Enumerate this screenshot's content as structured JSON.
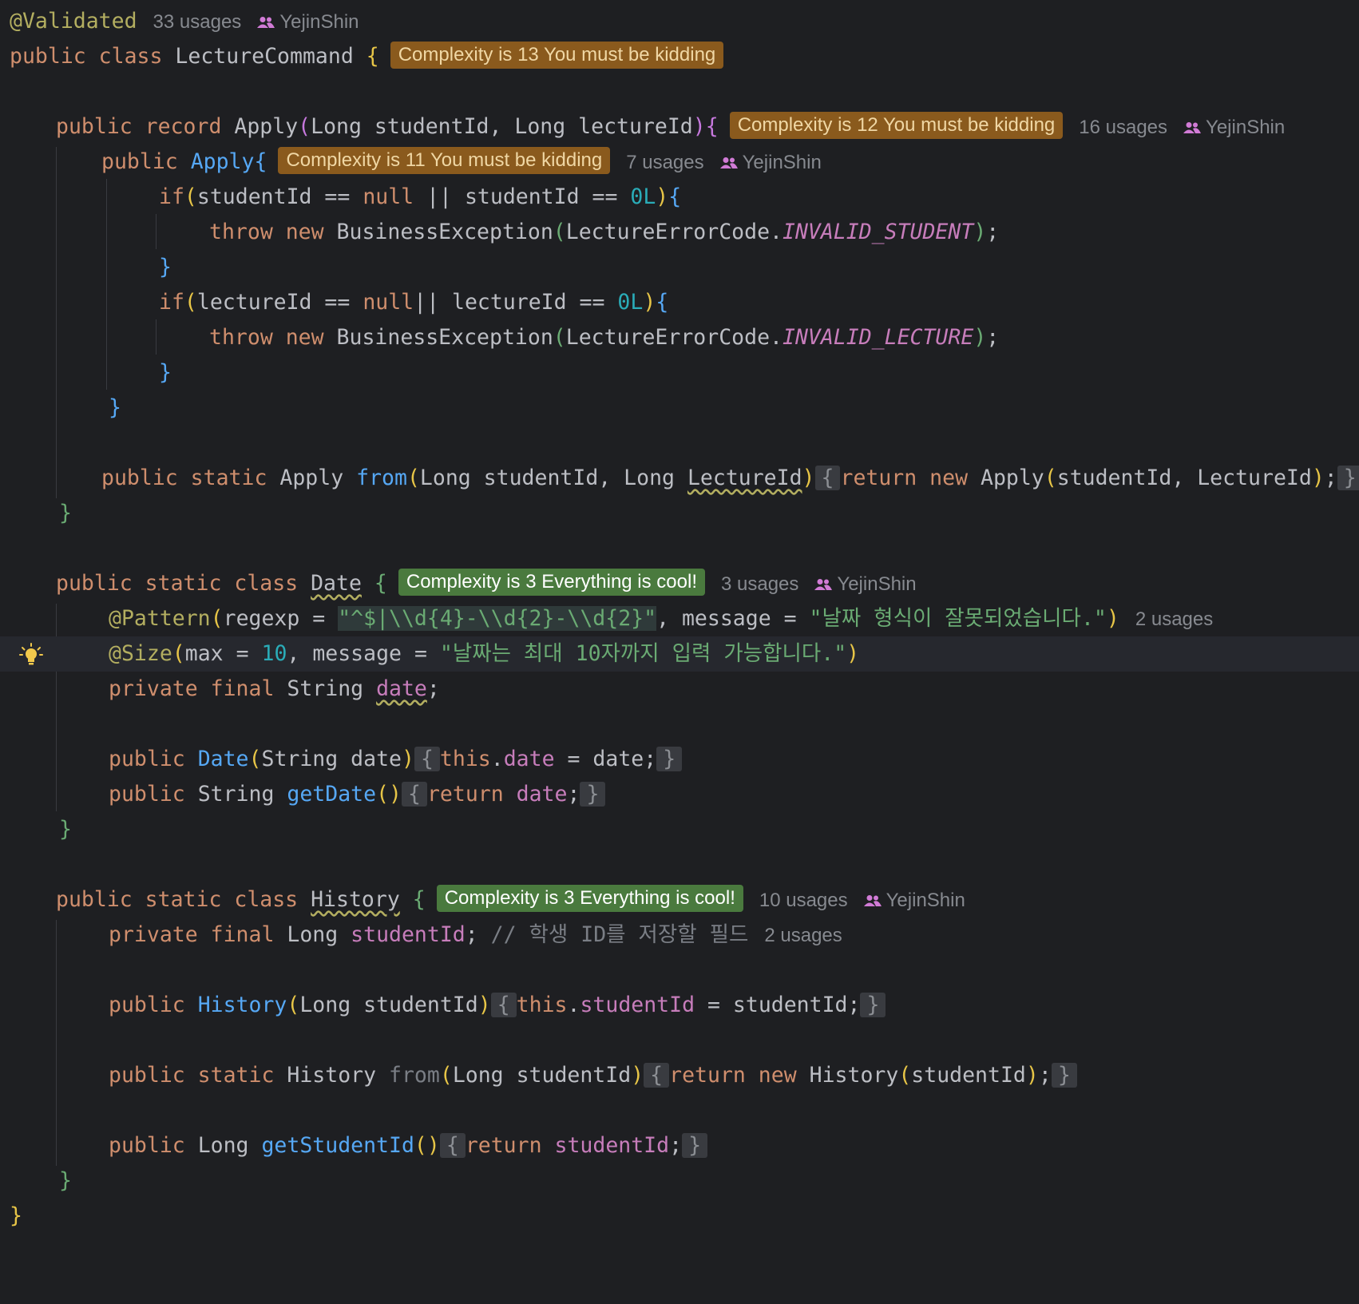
{
  "editor": {
    "colors": {
      "background": "#1e1f22",
      "badge_warning_bg": "#8a5a1d",
      "badge_warning_text": "#f0d7a4",
      "badge_ok_bg": "#4a7a3e",
      "badge_ok_text": "#ffffff"
    },
    "icons": {
      "author": "user-group-icon",
      "intention": "lightbulb-icon"
    },
    "inlays": {
      "class_usages": "33 usages",
      "class_author": "YejinShin",
      "apply_usages": "16 usages",
      "apply_author": "YejinShin",
      "ctor_usages": "7 usages",
      "ctor_author": "YejinShin",
      "date_usages": "3 usages",
      "date_author": "YejinShin",
      "pattern_usages": "2 usages",
      "history_usages": "10 usages",
      "history_author": "YejinShin",
      "field_usages": "2 usages"
    },
    "badges": {
      "lecture_command": "Complexity is 13 You must be kidding",
      "apply_record": "Complexity is 12 You must be kidding",
      "apply_ctor": "Complexity is 11 You must be kidding",
      "date_class": "Complexity is 3 Everything is cool!",
      "history_class": "Complexity is 3 Everything is cool!"
    },
    "strings": {
      "regex": "\"^$|\\\\d{4}-\\\\d{2}-\\\\d{2}\"",
      "date_message": "\"날짜 형식이 잘못되었습니다.\"",
      "size_message": "\"날짜는 최대 10자까지 입력 가능합니다.\"",
      "comment": "// 학생 ID를 저장할 필드"
    },
    "lines": [
      "@Validated",
      "public class LectureCommand {",
      "",
      "    public record Apply(Long studentId, Long lectureId){",
      "        public Apply{",
      "            if(studentId == null || studentId == 0L){",
      "                throw new BusinessException(LectureErrorCode.INVALID_STUDENT);",
      "            }",
      "            if(lectureId == null|| lectureId == 0L){",
      "                throw new BusinessException(LectureErrorCode.INVALID_LECTURE);",
      "            }",
      "        }",
      "",
      "        public static Apply from(Long studentId, Long LectureId) { return new Apply(studentId, LectureId); }",
      "    }",
      "",
      "    public static class Date {",
      "        @Pattern(regexp = \"^$|\\\\d{4}-\\\\d{2}-\\\\d{2}\", message = \"날짜 형식이 잘못되었습니다.\")",
      "        @Size(max = 10, message = \"날짜는 최대 10자까지 입력 가능합니다.\")",
      "        private final String date;",
      "",
      "        public Date(String date) { this.date = date; }",
      "        public String getDate() { return date; }",
      "    }",
      "",
      "    public static class History {",
      "        private final Long studentId; // 학생 ID를 저장할 필드",
      "",
      "        public History(Long studentId) { this.studentId = studentId; }",
      "",
      "        public static History from(Long studentId) { return new History(studentId); }",
      "",
      "        public Long getStudentId() { return studentId; }",
      "    }",
      "}"
    ]
  }
}
